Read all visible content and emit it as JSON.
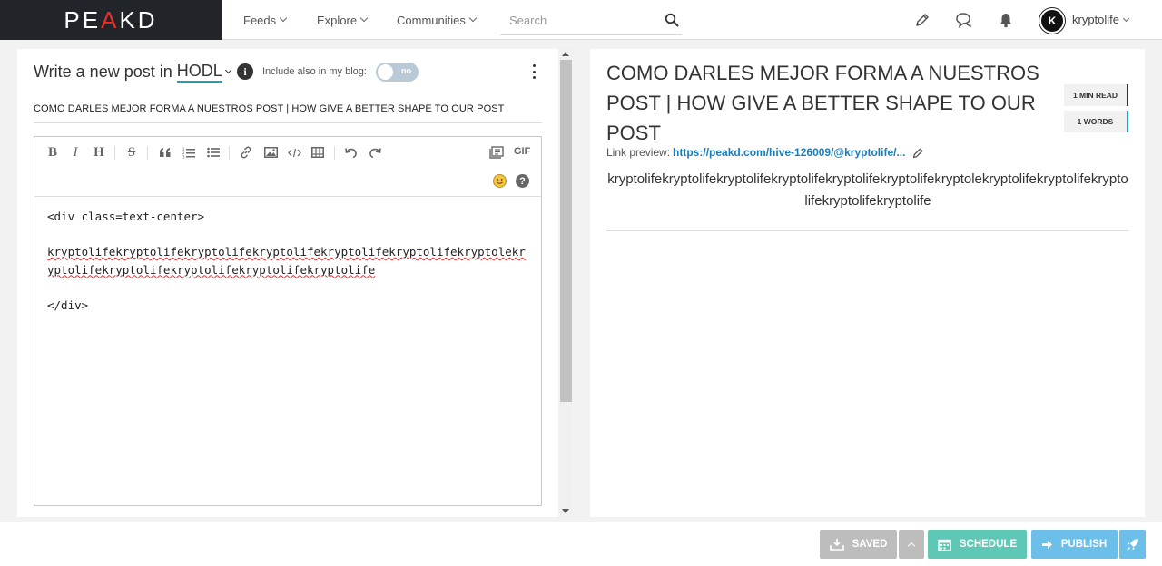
{
  "header": {
    "logo_prefix": "PE",
    "logo_accent": "A",
    "logo_suffix": "KD",
    "nav": [
      {
        "label": "Feeds"
      },
      {
        "label": "Explore"
      },
      {
        "label": "Communities"
      }
    ],
    "search_placeholder": "Search",
    "avatar_letter": "K",
    "username": "kryptolife"
  },
  "editor": {
    "write_label": "Write a new post in",
    "community": "HODL",
    "include_label": "Include also in my blog:",
    "toggle_label": "no",
    "post_title": "COMO DARLES MEJOR FORMA A NUESTROS POST  | HOW GIVE A BETTER SHAPE TO OUR POST",
    "gif_label": "GIF",
    "help_label": "?",
    "code": {
      "line1": "<div class=text-center>",
      "line2": "kryptolifekryptolifekryptolifekryptolifekryptolifekryptolifekryptolekryptolifekryptolifekryptolifekryptolifekryptolife",
      "line3": "</div>"
    }
  },
  "preview": {
    "title": "COMO DARLES MEJOR FORMA A NUESTROS POST | HOW GIVE A BETTER SHAPE TO OUR POST",
    "min_read": "1 MIN READ",
    "words": "1 WORDS",
    "link_label": "Link preview:",
    "link_url": "https://peakd.com/hive-126009/@kryptolife/...",
    "body": "kryptolifekryptolifekryptolifekryptolifekryptolifekryptolifekryptolekryptolifekryptolifekryptolifekryptolifekryptolife"
  },
  "actions": {
    "saved": "SAVED",
    "schedule": "SCHEDULE",
    "publish": "PUBLISH"
  },
  "colors": {
    "accent": "#17a2b8",
    "link": "#1a7db8",
    "schedule": "#5fc7b6",
    "publish": "#6bbfe8",
    "saved": "#bdbdbd"
  }
}
